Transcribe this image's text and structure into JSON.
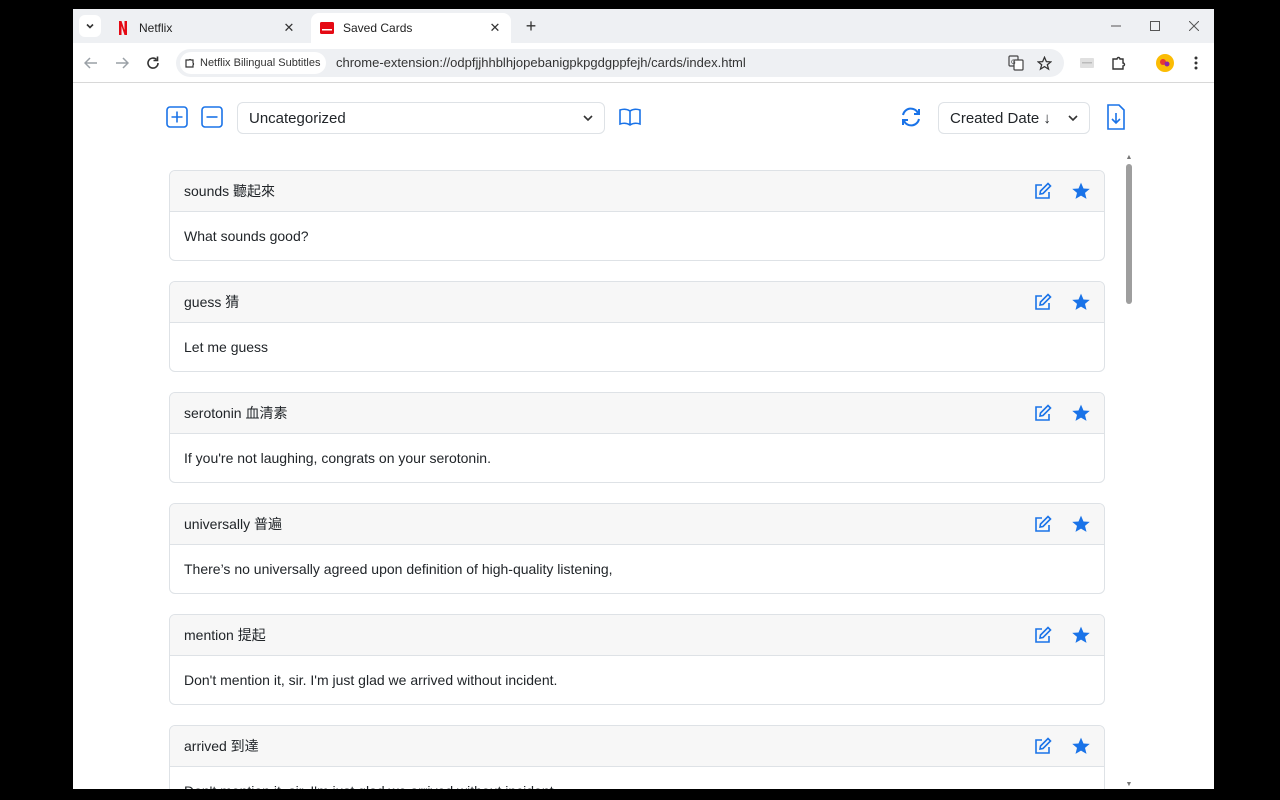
{
  "browser": {
    "tabs": [
      {
        "title": "Netflix",
        "active": false
      },
      {
        "title": "Saved Cards",
        "active": true
      }
    ],
    "site_chip": "Netflix Bilingual Subtitles",
    "url": "chrome-extension://odpfjjhhblhjopebanigpkpgdgppfejh/cards/index.html"
  },
  "controls": {
    "category": "Uncategorized",
    "sort": "Created Date ↓"
  },
  "colors": {
    "accent": "#1a73e8",
    "netflix_red": "#e50914"
  },
  "cards": [
    {
      "word": "sounds 聽起來",
      "sentence": "What sounds good?"
    },
    {
      "word": "guess 猜",
      "sentence": "Let me guess"
    },
    {
      "word": "serotonin 血清素",
      "sentence": "If you're not laughing, congrats on your serotonin."
    },
    {
      "word": "universally 普遍",
      "sentence": "There’s no universally agreed upon definition of high-quality listening,"
    },
    {
      "word": "mention 提起",
      "sentence": "Don't mention it, sir. I'm just glad we arrived without incident."
    },
    {
      "word": "arrived 到達",
      "sentence": "Don't mention it, sir. I'm just glad we arrived without incident."
    }
  ]
}
